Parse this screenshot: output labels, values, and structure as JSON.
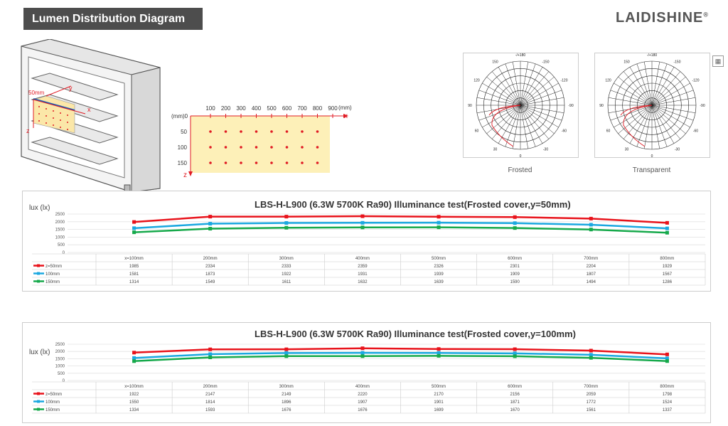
{
  "header": {
    "title": "Lumen Distribution Diagram",
    "brand": "LAIDISHINE",
    "brand_reg": "®"
  },
  "cabinet": {
    "label_50": "50mm",
    "label_y": "y",
    "label_x": "x",
    "label_z": "z"
  },
  "grid": {
    "x_ticks": [
      "100",
      "200",
      "300",
      "400",
      "500",
      "600",
      "700",
      "800",
      "900"
    ],
    "x_unit": "(mm)",
    "y_ticks": [
      "50",
      "100",
      "150"
    ],
    "origin": "(mm)0",
    "x_axis": "x",
    "z_axis": "z"
  },
  "polar": {
    "frosted": {
      "caption": "Frosted"
    },
    "transparent": {
      "caption": "Transparent"
    },
    "angles": [
      "-/+180",
      "150",
      "120",
      "90",
      "60",
      "30",
      "0",
      "-30",
      "-60",
      "-90",
      "-120",
      "-150"
    ]
  },
  "chart_data": [
    {
      "type": "line",
      "title": "LBS-H-L900 (6.3W 5700K Ra90) Illuminance test(Frosted cover,y=50mm)",
      "ylabel": "lux (lx)",
      "ylim": [
        0,
        2500
      ],
      "yticks": [
        "2500",
        "2000",
        "1500",
        "1000",
        "500",
        "0"
      ],
      "categories": [
        "x=100mm",
        "200mm",
        "300mm",
        "400mm",
        "500mm",
        "600mm",
        "700mm",
        "800mm"
      ],
      "series": [
        {
          "name": "z=50mm",
          "color": "#e8131b",
          "values": [
            1985,
            2334,
            2333,
            2359,
            2326,
            2301,
            2204,
            1929
          ]
        },
        {
          "name": "100mm",
          "color": "#1ba8e0",
          "values": [
            1581,
            1873,
            1922,
            1931,
            1939,
            1909,
            1807,
            1567
          ]
        },
        {
          "name": "150mm",
          "color": "#16a94b",
          "values": [
            1314,
            1549,
            1611,
            1632,
            1639,
            1590,
            1494,
            1286
          ]
        }
      ]
    },
    {
      "type": "line",
      "title": "LBS-H-L900 (6.3W 5700K Ra90) Illuminance test(Frosted cover,y=100mm)",
      "ylabel": "lux (lx)",
      "ylim": [
        0,
        2500
      ],
      "yticks": [
        "2500",
        "2000",
        "1500",
        "1000",
        "500",
        "0"
      ],
      "categories": [
        "x=100mm",
        "200mm",
        "300mm",
        "400mm",
        "500mm",
        "600mm",
        "700mm",
        "800mm"
      ],
      "series": [
        {
          "name": "z=50mm",
          "color": "#e8131b",
          "values": [
            1922,
            2147,
            2149,
            2220,
            2170,
            2156,
            2059,
            1798
          ]
        },
        {
          "name": "100mm",
          "color": "#1ba8e0",
          "values": [
            1550,
            1814,
            1896,
            1907,
            1901,
            1871,
            1772,
            1524
          ]
        },
        {
          "name": "150mm",
          "color": "#16a94b",
          "values": [
            1334,
            1593,
            1676,
            1676,
            1699,
            1670,
            1561,
            1337
          ]
        }
      ]
    }
  ]
}
